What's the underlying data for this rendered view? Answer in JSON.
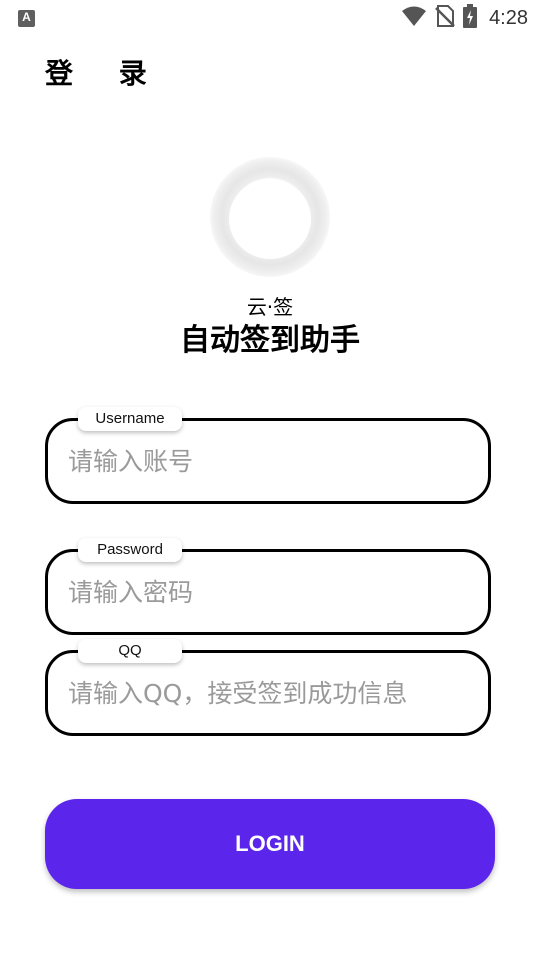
{
  "status_bar": {
    "notification_icon": "A",
    "time": "4:28",
    "icons": [
      "wifi-icon",
      "no-sim-icon",
      "battery-charging-icon"
    ]
  },
  "header": {
    "title": "登 录"
  },
  "app": {
    "subname": "云·签",
    "name": "自动签到助手"
  },
  "form": {
    "username": {
      "label": "Username",
      "placeholder": "请输入账号",
      "value": ""
    },
    "password": {
      "label": "Password",
      "placeholder": "请输入密码",
      "value": ""
    },
    "qq": {
      "label": "QQ",
      "placeholder": "请输入QQ，接受签到成功信息",
      "value": ""
    }
  },
  "actions": {
    "login_label": "LOGIN"
  },
  "colors": {
    "accent": "#5b25ec",
    "field_border": "#000000",
    "placeholder": "#9a9a9a"
  }
}
